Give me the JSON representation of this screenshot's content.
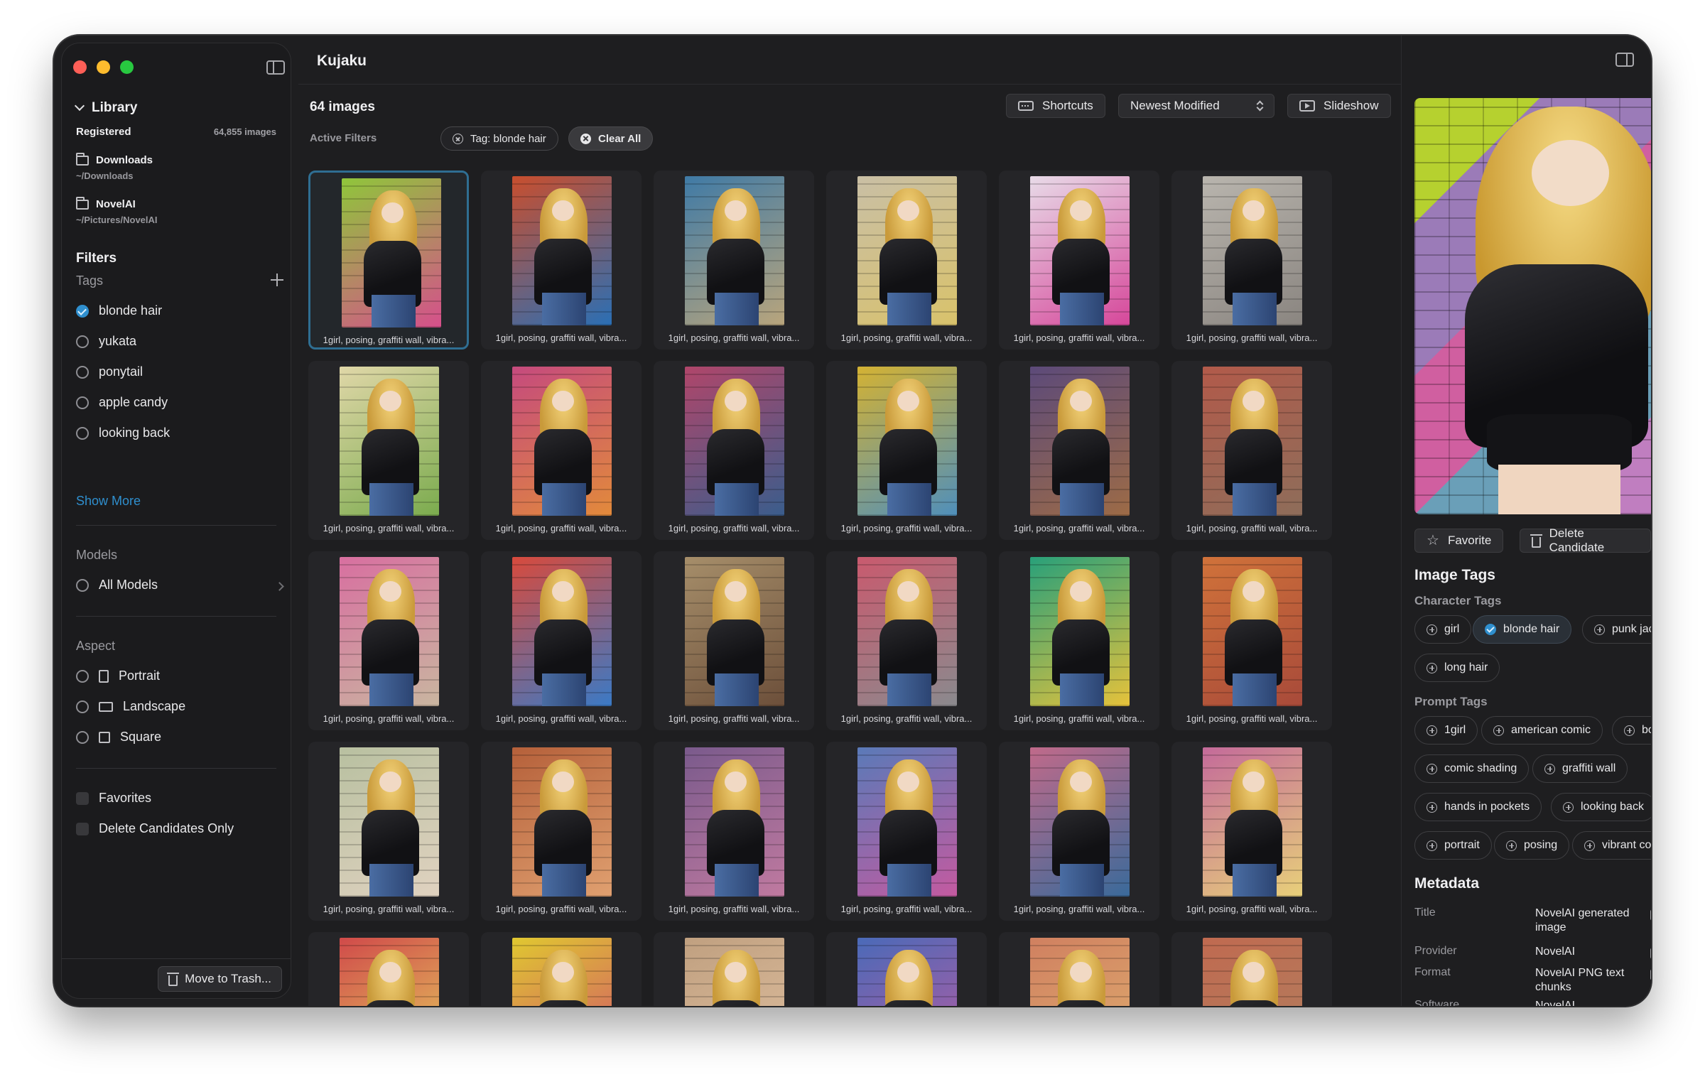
{
  "app": {
    "title": "Kujaku"
  },
  "sidebar": {
    "library_label": "Library",
    "registered_label": "Registered",
    "registered_count": "64,855 images",
    "folders": [
      {
        "name": "Downloads",
        "path": "~/Downloads"
      },
      {
        "name": "NovelAI",
        "path": "~/Pictures/NovelAI"
      }
    ],
    "filters_label": "Filters",
    "tags_label": "Tags",
    "tags": [
      {
        "label": "blonde hair",
        "selected": true
      },
      {
        "label": "yukata",
        "selected": false
      },
      {
        "label": "ponytail",
        "selected": false
      },
      {
        "label": "apple candy",
        "selected": false
      },
      {
        "label": "looking back",
        "selected": false
      }
    ],
    "show_more": "Show More",
    "models_label": "Models",
    "all_models": "All Models",
    "aspect_label": "Aspect",
    "aspects": [
      "Portrait",
      "Landscape",
      "Square"
    ],
    "favorites": "Favorites",
    "delete_candidates_only": "Delete Candidates Only",
    "move_to_trash": "Move to Trash..."
  },
  "main": {
    "count": "64 images",
    "shortcuts": "Shortcuts",
    "sort": "Newest Modified",
    "slideshow": "Slideshow",
    "active_filters_label": "Active Filters",
    "filter_chip": "Tag: blonde hair",
    "clear_all": "Clear All",
    "caption": "1girl, posing, graffiti wall, vibra..."
  },
  "thumbs": [
    [
      "#8fc63a",
      "#d64f8c"
    ],
    [
      "#c94e2d",
      "#2a6fb5"
    ],
    [
      "#3f7aa6",
      "#b9a57c"
    ],
    [
      "#c9bfa5",
      "#d9c26b"
    ],
    [
      "#e8dbe8",
      "#d6479a"
    ],
    [
      "#b9b5ae",
      "#8a8580"
    ],
    [
      "#e0d7a8",
      "#7bab4e"
    ],
    [
      "#c54a7e",
      "#e28a3b"
    ],
    [
      "#b0466a",
      "#3a5d8c"
    ],
    [
      "#d4b233",
      "#4f8fbb"
    ],
    [
      "#5c4a7a",
      "#9d6b46"
    ],
    [
      "#b25a4a",
      "#8e6d5a"
    ],
    [
      "#d86fa0",
      "#c9b6a0"
    ],
    [
      "#d84a3c",
      "#3a7ac6"
    ],
    [
      "#a68e6a",
      "#6c4f3a"
    ],
    [
      "#c95a6e",
      "#8a8a8e"
    ],
    [
      "#28a07a",
      "#e6c23b"
    ],
    [
      "#d0723a",
      "#a84a3a"
    ],
    [
      "#b8c0a0",
      "#e0d2c0"
    ],
    [
      "#b5603a",
      "#e0a070"
    ],
    [
      "#7a5a8c",
      "#c07aa0"
    ],
    [
      "#5a7ab8",
      "#c45aa0"
    ],
    [
      "#c06a8a",
      "#3a6a9a"
    ],
    [
      "#c46a9a",
      "#e8d07a"
    ],
    [
      "#d04a4a",
      "#e8d860"
    ],
    [
      "#e0c830",
      "#d04870"
    ],
    [
      "#c0a080",
      "#e0c0a0"
    ],
    [
      "#4a6ab8",
      "#c05aa0"
    ],
    [
      "#d08060",
      "#e0b070"
    ],
    [
      "#c06a50",
      "#b08060"
    ]
  ],
  "detail": {
    "favorite": "Favorite",
    "delete_candidate": "Delete Candidate",
    "image_tags": "Image Tags",
    "character_tags_label": "Character Tags",
    "character_tags": [
      {
        "label": "girl",
        "selected": false
      },
      {
        "label": "blonde hair",
        "selected": true
      },
      {
        "label": "punk jacket",
        "selected": false
      },
      {
        "label": "long hair",
        "selected": false
      }
    ],
    "prompt_tags_label": "Prompt Tags",
    "prompt_tags": [
      "1girl",
      "american comic",
      "bold",
      "comic shading",
      "graffiti wall",
      "hands in pockets",
      "looking back",
      "portrait",
      "posing",
      "vibrant color"
    ],
    "metadata_label": "Metadata",
    "metadata": [
      {
        "key": "Title",
        "value": "NovelAI generated image"
      },
      {
        "key": "Provider",
        "value": "NovelAI"
      },
      {
        "key": "Format",
        "value": "NovelAI PNG text chunks"
      },
      {
        "key": "Software",
        "value": "NovelAI"
      }
    ]
  }
}
